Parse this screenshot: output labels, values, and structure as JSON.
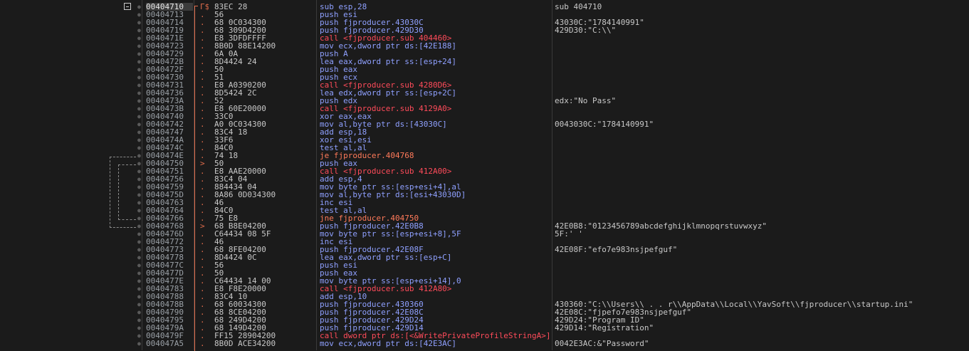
{
  "toolbar": {
    "collapse_icon": "collapse-minus-icon"
  },
  "rows": [
    {
      "addr": "00404710",
      "flag": "Γ$",
      "bytes": "83EC 28",
      "instr": "sub esp,28",
      "comment": "sub_404710",
      "kind": "normal"
    },
    {
      "addr": "00404713",
      "flag": ".",
      "bytes": "56",
      "instr": "push esi",
      "comment": "",
      "kind": "normal"
    },
    {
      "addr": "00404714",
      "flag": ".",
      "bytes": "68 0C034300",
      "instr": "push fjproducer.43030C",
      "comment": "43030C:\"1784140991\"",
      "kind": "normal"
    },
    {
      "addr": "00404719",
      "flag": ".",
      "bytes": "68 309D4200",
      "instr": "push fjproducer.429D30",
      "comment": "429D30:\"C:\\\\\"",
      "kind": "normal"
    },
    {
      "addr": "0040471E",
      "flag": ".",
      "bytes": "E8 3DFDFFFF",
      "instr": "call <fjproducer.sub_404460>",
      "comment": "",
      "kind": "call"
    },
    {
      "addr": "00404723",
      "flag": ".",
      "bytes": "8B0D 88E14200",
      "instr": "mov ecx,dword ptr ds:[42E188]",
      "comment": "",
      "kind": "normal"
    },
    {
      "addr": "00404729",
      "flag": ".",
      "bytes": "6A 0A",
      "instr": "push A",
      "comment": "",
      "kind": "normal"
    },
    {
      "addr": "0040472B",
      "flag": ".",
      "bytes": "8D4424 24",
      "instr": "lea eax,dword ptr ss:[esp+24]",
      "comment": "",
      "kind": "normal"
    },
    {
      "addr": "0040472F",
      "flag": ".",
      "bytes": "50",
      "instr": "push eax",
      "comment": "",
      "kind": "normal"
    },
    {
      "addr": "00404730",
      "flag": ".",
      "bytes": "51",
      "instr": "push ecx",
      "comment": "",
      "kind": "normal"
    },
    {
      "addr": "00404731",
      "flag": ".",
      "bytes": "E8 A0390200",
      "instr": "call <fjproducer.sub_4280D6>",
      "comment": "",
      "kind": "call"
    },
    {
      "addr": "00404736",
      "flag": ".",
      "bytes": "8D5424 2C",
      "instr": "lea edx,dword ptr ss:[esp+2C]",
      "comment": "",
      "kind": "normal"
    },
    {
      "addr": "0040473A",
      "flag": ".",
      "bytes": "52",
      "instr": "push edx",
      "comment": "edx:\"No Pass\"",
      "kind": "normal"
    },
    {
      "addr": "0040473B",
      "flag": ".",
      "bytes": "E8 60E20000",
      "instr": "call <fjproducer.sub_4129A0>",
      "comment": "",
      "kind": "call"
    },
    {
      "addr": "00404740",
      "flag": ".",
      "bytes": "33C0",
      "instr": "xor eax,eax",
      "comment": "",
      "kind": "normal"
    },
    {
      "addr": "00404742",
      "flag": ".",
      "bytes": "A0 0C034300",
      "instr": "mov al,byte ptr ds:[43030C]",
      "comment": "0043030C:\"1784140991\"",
      "kind": "normal"
    },
    {
      "addr": "00404747",
      "flag": ".",
      "bytes": "83C4 18",
      "instr": "add esp,18",
      "comment": "",
      "kind": "normal"
    },
    {
      "addr": "0040474A",
      "flag": ".",
      "bytes": "33F6",
      "instr": "xor esi,esi",
      "comment": "",
      "kind": "normal"
    },
    {
      "addr": "0040474C",
      "flag": ".",
      "bytes": "84C0",
      "instr": "test al,al",
      "comment": "",
      "kind": "normal"
    },
    {
      "addr": "0040474E",
      "flag": ".",
      "bytes": "74 18",
      "instr": "je fjproducer.404768",
      "comment": "",
      "kind": "jmp"
    },
    {
      "addr": "00404750",
      "flag": ">",
      "bytes": "50",
      "instr": "push eax",
      "comment": "",
      "kind": "normal"
    },
    {
      "addr": "00404751",
      "flag": ".",
      "bytes": "E8 AAE20000",
      "instr": "call <fjproducer.sub_412A00>",
      "comment": "",
      "kind": "call"
    },
    {
      "addr": "00404756",
      "flag": ".",
      "bytes": "83C4 04",
      "instr": "add esp,4",
      "comment": "",
      "kind": "normal"
    },
    {
      "addr": "00404759",
      "flag": ".",
      "bytes": "884434 04",
      "instr": "mov byte ptr ss:[esp+esi+4],al",
      "comment": "",
      "kind": "normal"
    },
    {
      "addr": "0040475D",
      "flag": ".",
      "bytes": "8A86 0D034300",
      "instr": "mov al,byte ptr ds:[esi+43030D]",
      "comment": "",
      "kind": "normal"
    },
    {
      "addr": "00404763",
      "flag": ".",
      "bytes": "46",
      "instr": "inc esi",
      "comment": "",
      "kind": "normal"
    },
    {
      "addr": "00404764",
      "flag": ".",
      "bytes": "84C0",
      "instr": "test al,al",
      "comment": "",
      "kind": "normal"
    },
    {
      "addr": "00404766",
      "flag": ".",
      "bytes": "75 E8",
      "instr": "jne fjproducer.404750",
      "comment": "",
      "kind": "jmp"
    },
    {
      "addr": "00404768",
      "flag": ">",
      "bytes": "68 B8E04200",
      "instr": "push fjproducer.42E0B8",
      "comment": "42E0B8:\"0123456789abcdefghijklmnopqrstuvwxyz\"",
      "kind": "normal"
    },
    {
      "addr": "0040476D",
      "flag": ".",
      "bytes": "C64434 08 5F",
      "instr": "mov byte ptr ss:[esp+esi+8],5F",
      "comment": "5F:'_'",
      "kind": "normal"
    },
    {
      "addr": "00404772",
      "flag": ".",
      "bytes": "46",
      "instr": "inc esi",
      "comment": "",
      "kind": "normal"
    },
    {
      "addr": "00404773",
      "flag": ".",
      "bytes": "68 8FE04200",
      "instr": "push fjproducer.42E08F",
      "comment": "42E08F:\"efo7e983nsjpefguf\"",
      "kind": "normal"
    },
    {
      "addr": "00404778",
      "flag": ".",
      "bytes": "8D4424 0C",
      "instr": "lea eax,dword ptr ss:[esp+C]",
      "comment": "",
      "kind": "normal"
    },
    {
      "addr": "0040477C",
      "flag": ".",
      "bytes": "56",
      "instr": "push esi",
      "comment": "",
      "kind": "normal"
    },
    {
      "addr": "0040477D",
      "flag": ".",
      "bytes": "50",
      "instr": "push eax",
      "comment": "",
      "kind": "normal"
    },
    {
      "addr": "0040477E",
      "flag": ".",
      "bytes": "C64434 14 00",
      "instr": "mov byte ptr ss:[esp+esi+14],0",
      "comment": "",
      "kind": "normal"
    },
    {
      "addr": "00404783",
      "flag": ".",
      "bytes": "E8 F8E20000",
      "instr": "call <fjproducer.sub_412A80>",
      "comment": "",
      "kind": "call"
    },
    {
      "addr": "00404788",
      "flag": ".",
      "bytes": "83C4 10",
      "instr": "add esp,10",
      "comment": "",
      "kind": "normal"
    },
    {
      "addr": "0040478B",
      "flag": ".",
      "bytes": "68 60034300",
      "instr": "push fjproducer.430360",
      "comment": "430360:\"C:\\\\Users\\\\ . . r\\\\AppData\\\\Local\\\\YavSoft\\\\fjproducer\\\\startup.ini\"",
      "kind": "normal"
    },
    {
      "addr": "00404790",
      "flag": ".",
      "bytes": "68 8CE04200",
      "instr": "push fjproducer.42E08C",
      "comment": "42E08C:\"fjpefo7e983nsjpefguf\"",
      "kind": "normal"
    },
    {
      "addr": "00404795",
      "flag": ".",
      "bytes": "68 249D4200",
      "instr": "push fjproducer.429D24",
      "comment": "429D24:\"Program ID\"",
      "kind": "normal"
    },
    {
      "addr": "0040479A",
      "flag": ".",
      "bytes": "68 149D4200",
      "instr": "push fjproducer.429D14",
      "comment": "429D14:\"Registration\"",
      "kind": "normal"
    },
    {
      "addr": "0040479F",
      "flag": ".",
      "bytes": "FF15 28904200",
      "instr": "call dword ptr ds:[<&WritePrivateProfileStringA>]",
      "comment": "",
      "kind": "call"
    },
    {
      "addr": "004047A5",
      "flag": ".",
      "bytes": "8B0D ACE34200",
      "instr": "mov ecx,dword ptr ds:[42E3AC]",
      "comment": "0042E3AC:&\"Password\"",
      "kind": "normal"
    }
  ]
}
